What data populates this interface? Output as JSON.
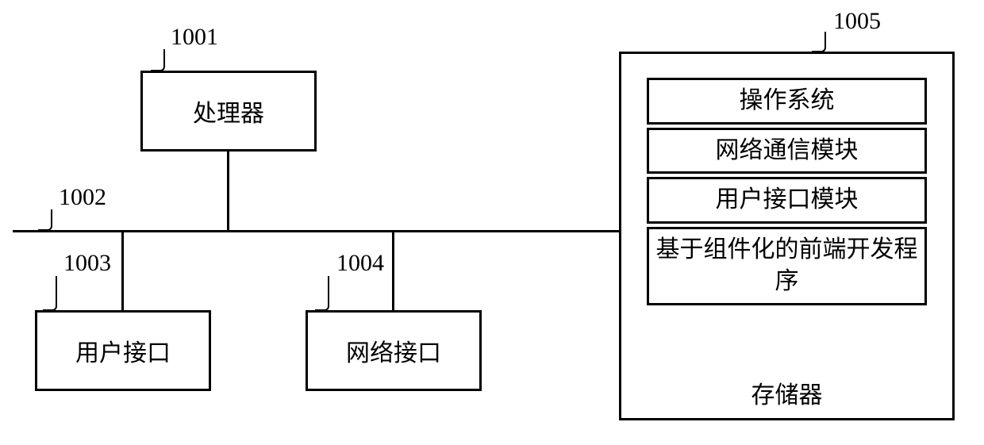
{
  "labels": {
    "processor_num": "1001",
    "bus_num": "1002",
    "user_if_num": "1003",
    "net_if_num": "1004",
    "storage_num": "1005"
  },
  "blocks": {
    "processor": "处理器",
    "user_interface": "用户接口",
    "network_interface": "网络接口",
    "storage": "存储器"
  },
  "storage_items": {
    "os": "操作系统",
    "net_module": "网络通信模块",
    "ui_module": "用户接口模块",
    "frontend": "基于组件化的前端开发程序"
  }
}
